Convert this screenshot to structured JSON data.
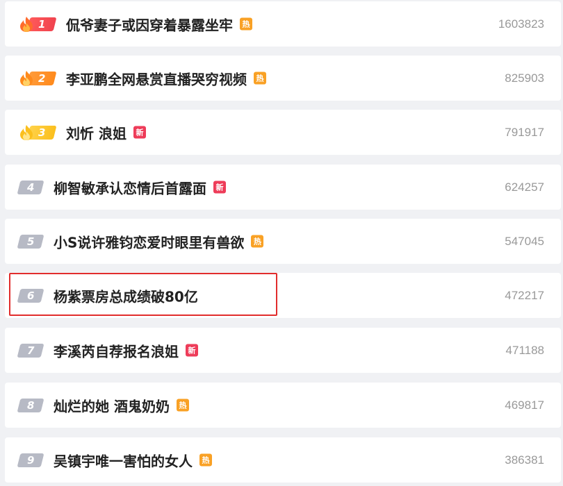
{
  "trending": {
    "items": [
      {
        "rank": "1",
        "title": "侃爷妻子或因穿着暴露坐牢",
        "tag": "热",
        "tag_type": "hot",
        "count": "1603823"
      },
      {
        "rank": "2",
        "title": "李亚鹏全网悬赏直播哭穷视频",
        "tag": "热",
        "tag_type": "hot",
        "count": "825903"
      },
      {
        "rank": "3",
        "title": "刘忻 浪姐",
        "tag": "新",
        "tag_type": "new",
        "count": "791917"
      },
      {
        "rank": "4",
        "title": "柳智敏承认恋情后首露面",
        "tag": "新",
        "tag_type": "new",
        "count": "624257"
      },
      {
        "rank": "5",
        "title": "小S说许雅钧恋爱时眼里有兽欲",
        "tag": "热",
        "tag_type": "hot",
        "count": "547045"
      },
      {
        "rank": "6",
        "title": "杨紫票房总成绩破80亿",
        "tag": "",
        "tag_type": "",
        "count": "472217"
      },
      {
        "rank": "7",
        "title": "李溪芮自荐报名浪姐",
        "tag": "新",
        "tag_type": "new",
        "count": "471188"
      },
      {
        "rank": "8",
        "title": "灿烂的她 酒鬼奶奶",
        "tag": "热",
        "tag_type": "hot",
        "count": "469817"
      },
      {
        "rank": "9",
        "title": "吴镇宇唯一害怕的女人",
        "tag": "热",
        "tag_type": "hot",
        "count": "386381"
      }
    ]
  },
  "colors": {
    "hot": "#f9a125",
    "new": "#ee3c59",
    "highlight": "#e12c2c",
    "rank_default": "#b7bac5"
  },
  "icons": {
    "flame": "flame-icon"
  }
}
